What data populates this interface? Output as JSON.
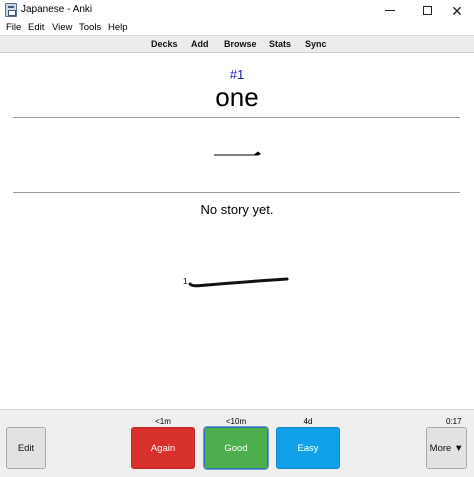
{
  "window": {
    "title": "Japanese - Anki",
    "close_glyph": "✕"
  },
  "menu": {
    "items": [
      "File",
      "Edit",
      "View",
      "Tools",
      "Help"
    ]
  },
  "toolbar": {
    "items": [
      "Decks",
      "Add",
      "Browse",
      "Stats",
      "Sync"
    ]
  },
  "card": {
    "number": "#1",
    "word": "one",
    "story": "No story yet.",
    "stroke_number": "1"
  },
  "review": {
    "edit_label": "Edit",
    "more_label": "More ▼",
    "timer": "0:17",
    "answers": [
      {
        "label": "Again",
        "interval": "<1m",
        "color": "#d8312b"
      },
      {
        "label": "Good",
        "interval": "<10m",
        "color": "#4cae4c"
      },
      {
        "label": "Easy",
        "interval": "4d",
        "color": "#11a1e8"
      }
    ]
  },
  "icons": {
    "app": "anki-app-icon",
    "minimize": "minimize-icon",
    "maximize": "maximize-icon",
    "close": "close-icon"
  }
}
